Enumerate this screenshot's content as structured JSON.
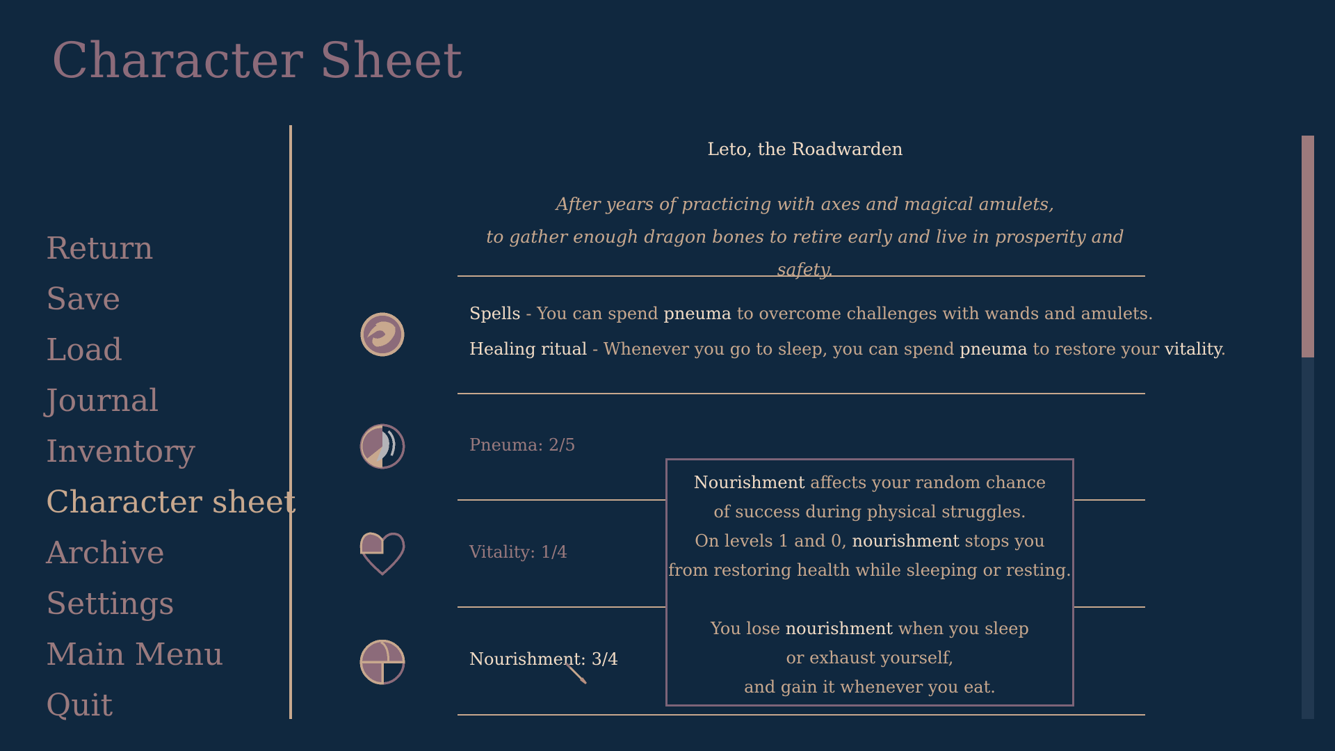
{
  "page": {
    "title": "Character Sheet"
  },
  "menu": {
    "items": [
      {
        "label": "Return",
        "active": false
      },
      {
        "label": "Save",
        "active": false
      },
      {
        "label": "Load",
        "active": false
      },
      {
        "label": "Journal",
        "active": false
      },
      {
        "label": "Inventory",
        "active": false
      },
      {
        "label": "Character sheet",
        "active": true
      },
      {
        "label": "Archive",
        "active": false
      },
      {
        "label": "Settings",
        "active": false
      },
      {
        "label": "Main Menu",
        "active": false
      },
      {
        "label": "Quit",
        "active": false
      }
    ]
  },
  "character": {
    "name": "Leto, the Roadwarden",
    "description_lines": [
      "After years of practicing with axes and magical amulets,",
      "to gather enough dragon bones to retire early and live in prosperity and safety."
    ]
  },
  "perks": {
    "icon": "pneuma-orb-icon",
    "spells": {
      "name": "Spells",
      "sep": " - ",
      "text1": "You can spend ",
      "key1": "pneuma",
      "text2": " to overcome challenges with wands and amulets."
    },
    "healing": {
      "name": "Healing ritual",
      "sep": " - ",
      "text1": "Whenever you go to sleep, you can spend ",
      "key1": "pneuma",
      "text2": " to restore your ",
      "key2": "vitality",
      "text3": "."
    }
  },
  "stats": {
    "pneuma": {
      "label": "Pneuma: 2/5",
      "current": 2,
      "max": 5,
      "icon": "pneuma-partial-icon"
    },
    "vitality": {
      "label": "Vitality: 1/4",
      "current": 1,
      "max": 4,
      "icon": "heart-quarter-icon"
    },
    "nourishment": {
      "label": "Nourishment: 3/4",
      "current": 3,
      "max": 4,
      "icon": "bread-three-quarter-icon",
      "hovered": true
    }
  },
  "tooltip": {
    "l1_key": "Nourishment",
    "l1_rest": " affects your random chance",
    "l2": "of success during physical struggles.",
    "l3_pre": "On levels 1 and 0, ",
    "l3_key": "nourishment",
    "l3_rest": " stops you",
    "l4": "from restoring health while sleeping or resting.",
    "l5_pre": "You lose ",
    "l5_key": "nourishment",
    "l5_rest": " when you sleep",
    "l6": "or exhaust yourself,",
    "l7": "and gain it whenever you eat."
  },
  "scrollbar": {
    "position_fraction": 0.0,
    "visible_fraction": 0.38
  },
  "colors": {
    "background": "#10283f",
    "title": "#8c6b7a",
    "menu_item": "#9a7a7e",
    "menu_active": "#c8a88e",
    "highlight_text": "#f2dcc6",
    "body_text": "#c8a88e",
    "tooltip_border": "#7d6478"
  }
}
